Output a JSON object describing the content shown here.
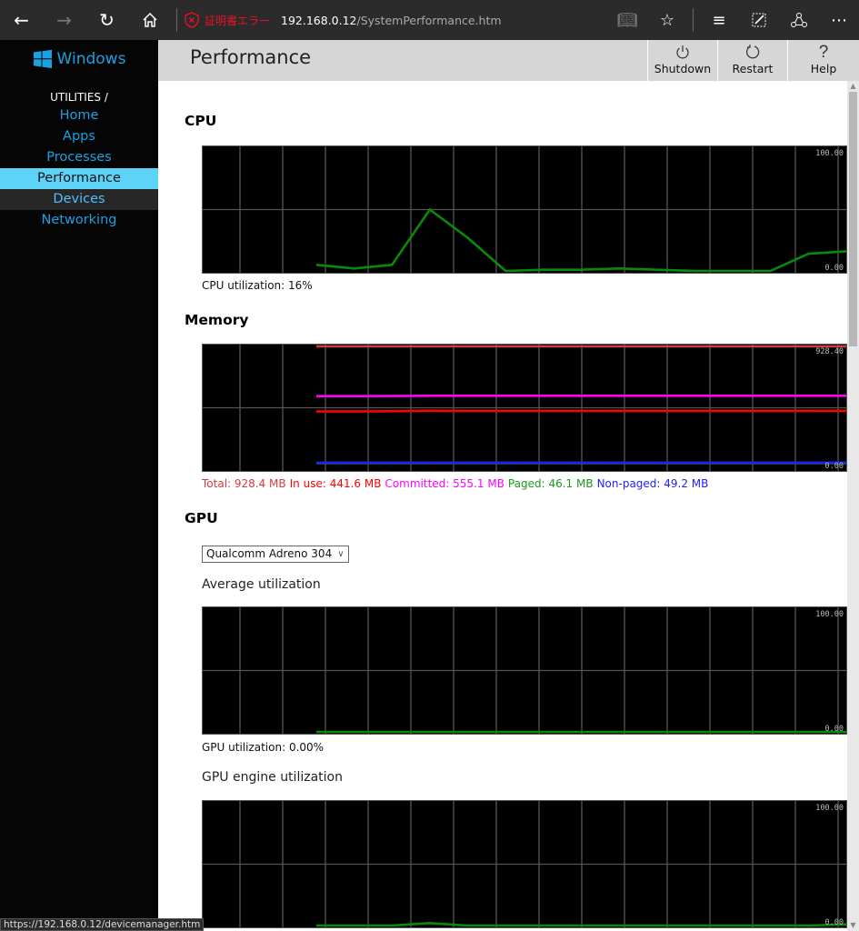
{
  "browser": {
    "cert_error": "証明書エラー",
    "url_host": "192.168.0.12",
    "url_path": "/SystemPerformance.htm",
    "status_url": "https://192.168.0.12/devicemanager.htm"
  },
  "sidebar": {
    "logo": "Windows",
    "section_label": "UTILITIES /",
    "items": [
      {
        "label": "Home"
      },
      {
        "label": "Apps"
      },
      {
        "label": "Processes"
      },
      {
        "label": "Performance"
      },
      {
        "label": "Devices"
      },
      {
        "label": "Networking"
      }
    ],
    "active": "Performance",
    "hovered": "Devices"
  },
  "header": {
    "title": "Performance",
    "buttons": [
      {
        "label": "Shutdown",
        "icon": "power-icon"
      },
      {
        "label": "Restart",
        "icon": "restart-icon"
      },
      {
        "label": "Help",
        "icon": "help-icon"
      }
    ]
  },
  "cpu": {
    "title": "CPU",
    "caption": "CPU utilization: 16%"
  },
  "memory": {
    "title": "Memory",
    "legend": [
      {
        "text": "Total: 928.4 MB",
        "color": "#d43b3b"
      },
      {
        "text": "In use: 441.6 MB",
        "color": "#ff0000"
      },
      {
        "text": "Committed: 555.1 MB",
        "color": "#ff00ff"
      },
      {
        "text": "Paged: 46.1 MB",
        "color": "#1a9a1a"
      },
      {
        "text": "Non-paged: 49.2 MB",
        "color": "#1f1fff"
      }
    ]
  },
  "gpu": {
    "title": "GPU",
    "selected_adapter": "Qualcomm Adreno 304",
    "avg_title": "Average utilization",
    "avg_caption": "GPU utilization: 0.00%",
    "engine_title": "GPU engine utilization"
  },
  "chart_data": [
    {
      "type": "line",
      "name": "cpu",
      "ymax_label": "100.00",
      "ymin_label": "0.00",
      "ylim": [
        0,
        100
      ],
      "series": [
        {
          "name": "CPU",
          "color": "#0a8a0a",
          "values": [
            null,
            null,
            null,
            5,
            2,
            5,
            50,
            27,
            0,
            1,
            1,
            2,
            1,
            0,
            0,
            0,
            14,
            16
          ]
        }
      ]
    },
    {
      "type": "line",
      "name": "memory",
      "ymax_label": "928.40",
      "ymin_label": "0.00",
      "ylim": [
        0,
        928.4
      ],
      "series": [
        {
          "name": "Total",
          "color": "#d43b3b",
          "values": [
            null,
            null,
            null,
            928.4,
            928.4,
            928.4,
            928.4,
            928.4,
            928.4,
            928.4,
            928.4,
            928.4,
            928.4,
            928.4,
            928.4,
            928.4,
            928.4,
            928.4
          ]
        },
        {
          "name": "Committed",
          "color": "#ff00ff",
          "values": [
            null,
            null,
            null,
            552,
            552,
            553,
            555,
            555,
            555,
            555,
            555,
            555,
            555,
            555,
            555,
            555,
            555,
            555.1
          ]
        },
        {
          "name": "In use",
          "color": "#ff0000",
          "values": [
            null,
            null,
            null,
            436,
            436,
            438,
            442,
            440,
            440,
            440,
            440,
            441,
            441,
            441,
            441,
            441,
            441,
            441.6
          ]
        },
        {
          "name": "Paged",
          "color": "#1a9a1a",
          "values": [
            null,
            null,
            null,
            46,
            46,
            46,
            46,
            46,
            46,
            46,
            46,
            46,
            46,
            46,
            46,
            46,
            46,
            46.1
          ]
        },
        {
          "name": "Non-paged",
          "color": "#1f1fff",
          "values": [
            null,
            null,
            null,
            49,
            49,
            49,
            49,
            49,
            49,
            49,
            49,
            49,
            49,
            49,
            49,
            49,
            49,
            49.2
          ]
        }
      ]
    },
    {
      "type": "line",
      "name": "gpu-average",
      "ymax_label": "100.00",
      "ymin_label": "0.00",
      "ylim": [
        0,
        100
      ],
      "series": [
        {
          "name": "GPU",
          "color": "#0a8a0a",
          "values": [
            null,
            null,
            null,
            0,
            0,
            0,
            0,
            0,
            0,
            0,
            0,
            0,
            0,
            0,
            0,
            0,
            0,
            0
          ]
        }
      ]
    },
    {
      "type": "line",
      "name": "gpu-engine",
      "ymax_label": "100.00",
      "ymin_label": "0.00",
      "ylim": [
        0,
        100
      ],
      "series": [
        {
          "name": "Engine",
          "color": "#0a8a0a",
          "values": [
            null,
            null,
            null,
            0,
            0,
            0,
            2,
            0,
            0,
            0,
            0,
            0,
            0,
            0,
            0,
            0,
            0,
            1
          ]
        }
      ]
    }
  ]
}
